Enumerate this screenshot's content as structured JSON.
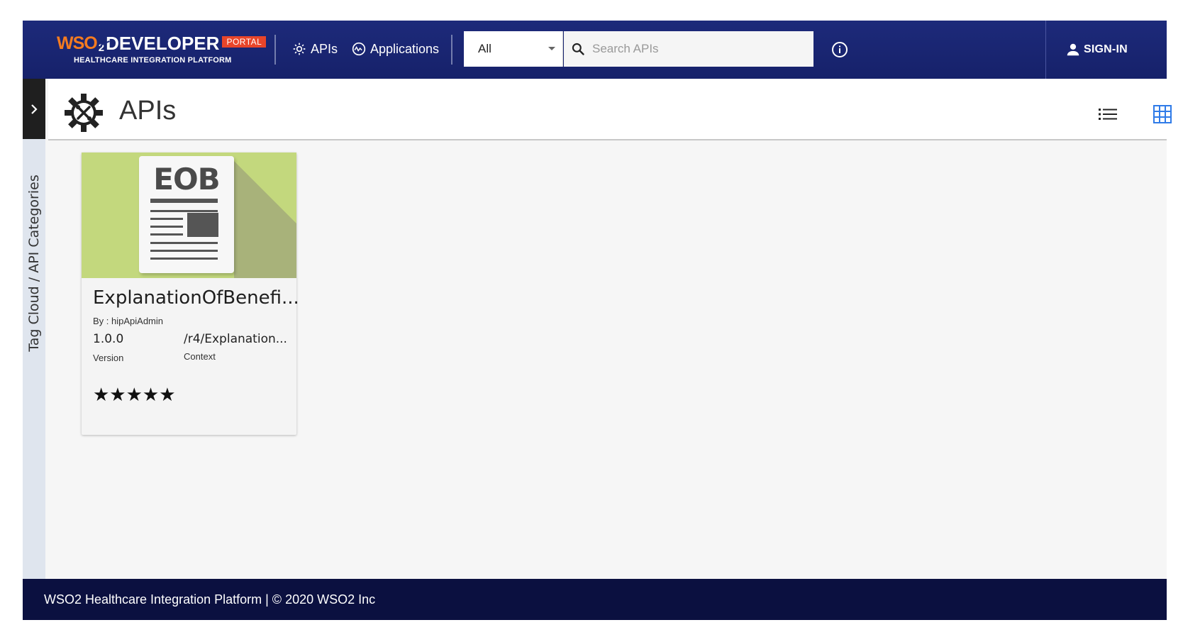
{
  "header": {
    "logo": {
      "brand": "WSO",
      "sub_two": "2",
      "product": "DEVELOPER",
      "badge": "PORTAL",
      "tagline": "HEALTHCARE INTEGRATION PLATFORM"
    },
    "nav": [
      {
        "label": "APIs",
        "icon": "gear-icon"
      },
      {
        "label": "Applications",
        "icon": "applications-icon"
      }
    ],
    "search": {
      "filter_selected": "All",
      "placeholder": "Search APIs"
    },
    "sign_in_label": "SIGN-IN",
    "accent_color": "#1d2a7a",
    "badge_color": "#e8452a"
  },
  "sidebar": {
    "label": "Tag Cloud / API Categories",
    "toggle_icon": "chevron-right-icon"
  },
  "page": {
    "title": "APIs",
    "title_icon": "api-gear-icon"
  },
  "apis": [
    {
      "thumbnail_text": "EOB",
      "name": "ExplanationOfBenefi...",
      "by": "By : hipApiAdmin",
      "version": "1.0.0",
      "version_label": "Version",
      "context": "/r4/Explanation...",
      "context_label": "Context",
      "rating": 5,
      "stars": "★★★★★",
      "thumb_color": "#c3d87d"
    }
  ],
  "footer": {
    "text": "WSO2 Healthcare Integration Platform | © 2020 WSO2 Inc"
  }
}
